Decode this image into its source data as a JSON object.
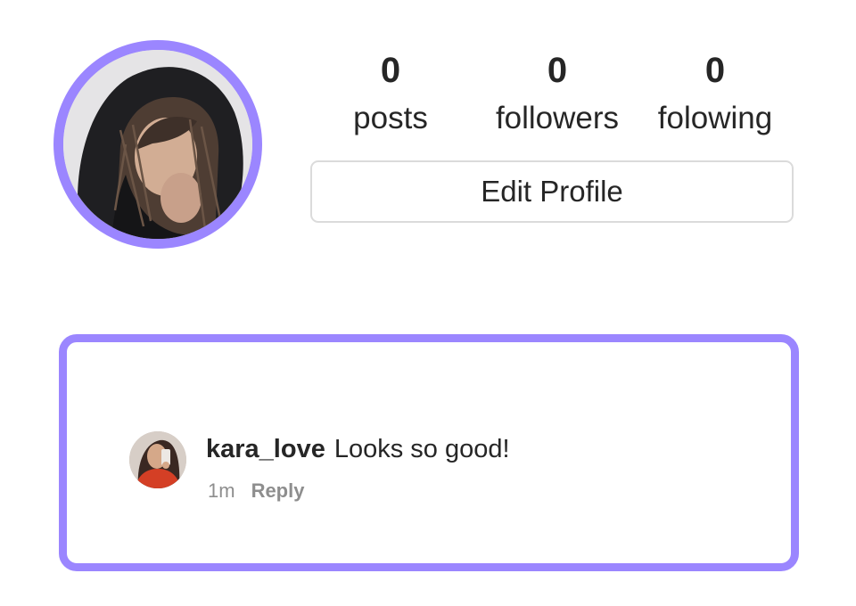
{
  "profile": {
    "avatar_icon": "profile-photo",
    "ring_color": "#9b86ff",
    "stats": [
      {
        "count": "0",
        "label": "posts"
      },
      {
        "count": "0",
        "label": "followers"
      },
      {
        "count": "0",
        "label": "folowing"
      }
    ],
    "edit_label": "Edit Profile"
  },
  "comment": {
    "border_color": "#9b86ff",
    "avatar_icon": "commenter-photo",
    "username": "kara_love",
    "text": "Looks so good!",
    "time": "1m",
    "reply_label": "Reply"
  }
}
